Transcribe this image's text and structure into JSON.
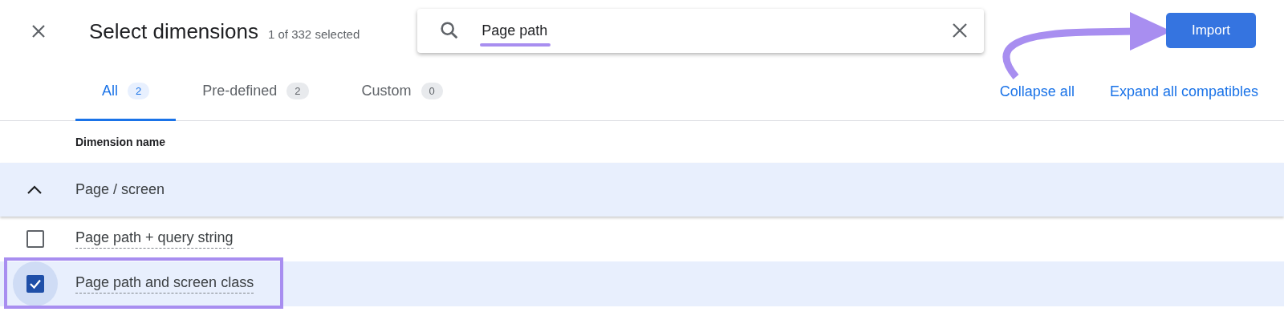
{
  "dialog": {
    "title": "Select dimensions",
    "selection_count": "1 of 332 selected"
  },
  "search": {
    "value": "Page path"
  },
  "import_button": "Import",
  "tabs": [
    {
      "label": "All",
      "count": "2",
      "selected": true
    },
    {
      "label": "Pre-defined",
      "count": "2",
      "selected": false
    },
    {
      "label": "Custom",
      "count": "0",
      "selected": false
    }
  ],
  "actions": [
    "Collapse all",
    "Expand all compatibles"
  ],
  "table": {
    "column": "Dimension name",
    "groups": [
      {
        "label": "Page / screen",
        "expanded": true,
        "children": [
          {
            "label": "Page path + query string",
            "checked": false
          },
          {
            "label": "Page path and screen class",
            "checked": true
          }
        ]
      }
    ]
  }
}
